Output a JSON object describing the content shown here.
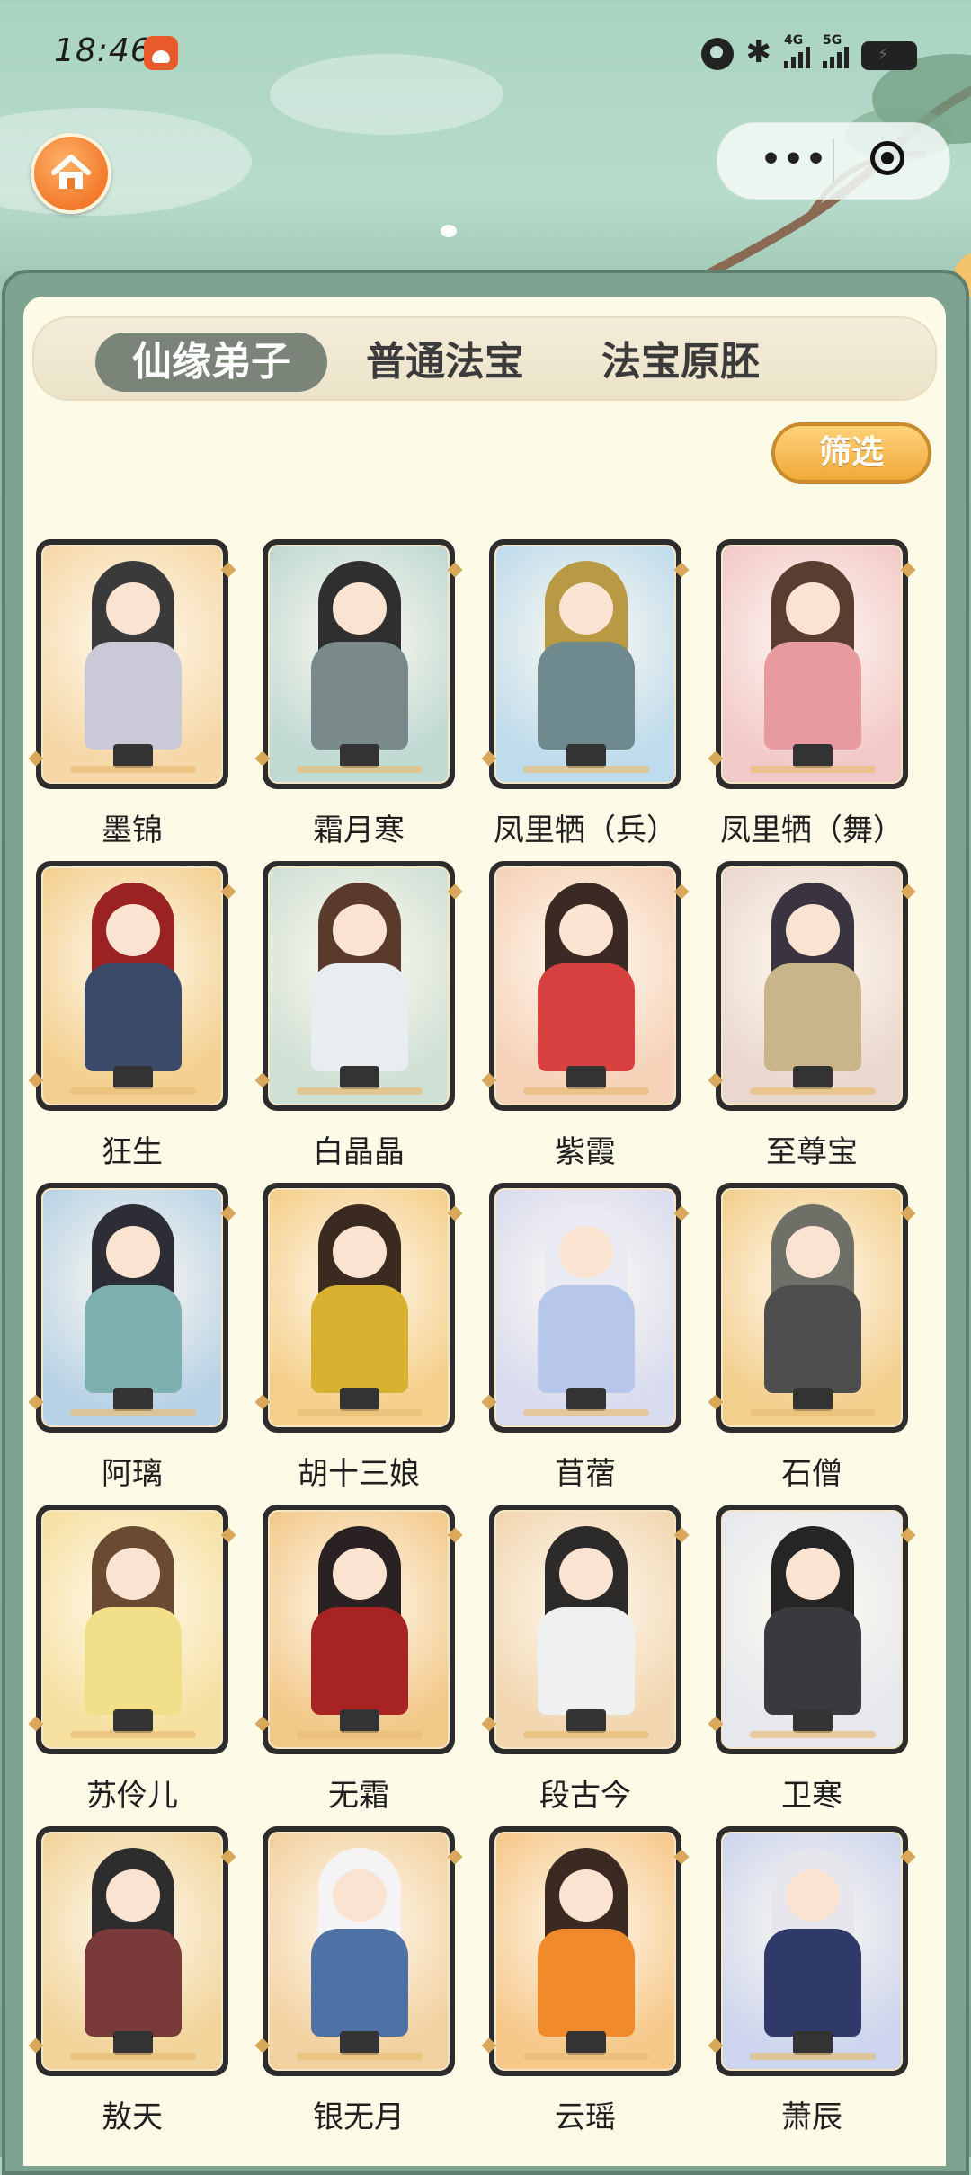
{
  "status_bar": {
    "time": "18:46",
    "network_1": "4G",
    "network_2": "5G"
  },
  "top_nav": {
    "home_icon": "home-icon",
    "capsule_more": "•••",
    "capsule_close_icon": "target-icon"
  },
  "tabs": [
    {
      "label": "仙缘弟子",
      "active": true
    },
    {
      "label": "普通法宝",
      "active": false
    },
    {
      "label": "法宝原胚",
      "active": false
    }
  ],
  "filter_label": "筛选",
  "characters": [
    {
      "name": "墨锦",
      "bg": "#f6d8a8",
      "hair": "#3a3a3a",
      "body": "#c9c9d8"
    },
    {
      "name": "霜月寒",
      "bg": "#bfd9d3",
      "hair": "#2f2f2f",
      "body": "#7a8a8a"
    },
    {
      "name": "凤里牺（兵）",
      "bg": "#bfdcec",
      "hair": "#b99a44",
      "body": "#6e8a8e"
    },
    {
      "name": "凤里牺（舞）",
      "bg": "#f2c9c9",
      "hair": "#5a3c30",
      "body": "#e79aa0"
    },
    {
      "name": "狂生",
      "bg": "#f3d08f",
      "hair": "#9a2222",
      "body": "#3c4a6a"
    },
    {
      "name": "白晶晶",
      "bg": "#cfe0d4",
      "hair": "#5a3a2a",
      "body": "#e8eef0"
    },
    {
      "name": "紫霞",
      "bg": "#f6d2b8",
      "hair": "#3b2a24",
      "body": "#d84040"
    },
    {
      "name": "至尊宝",
      "bg": "#ead8cf",
      "hair": "#3a3340",
      "body": "#c8b58a"
    },
    {
      "name": "阿璃",
      "bg": "#b9d3e6",
      "hair": "#2d2d36",
      "body": "#7fb0b0"
    },
    {
      "name": "胡十三娘",
      "bg": "#f5cf8a",
      "hair": "#3a2a20",
      "body": "#d8b030"
    },
    {
      "name": "苜蓿",
      "bg": "#d9dcef",
      "hair": "#eaeaf2",
      "body": "#b7c7ea"
    },
    {
      "name": "石僧",
      "bg": "#f3cf8d",
      "hair": "#6e7068",
      "body": "#4e4e4e"
    },
    {
      "name": "苏伶儿",
      "bg": "#f6e0a0",
      "hair": "#6a4a30",
      "body": "#f2df8a"
    },
    {
      "name": "无霜",
      "bg": "#f3c98a",
      "hair": "#2a2222",
      "body": "#a82424"
    },
    {
      "name": "段古今",
      "bg": "#f1d6b0",
      "hair": "#2d2a2a",
      "body": "#eef0f2"
    },
    {
      "name": "卫寒",
      "bg": "#e6e8ee",
      "hair": "#252526",
      "body": "#3a3a3e"
    },
    {
      "name": "敖天",
      "bg": "#f1d49a",
      "hair": "#2d2d2d",
      "body": "#7a3a3a"
    },
    {
      "name": "银无月",
      "bg": "#f2d1a0",
      "hair": "#f4f4f6",
      "body": "#4f72a6"
    },
    {
      "name": "云瑶",
      "bg": "#f6c88a",
      "hair": "#3a2a22",
      "body": "#f08a2a"
    },
    {
      "name": "萧辰",
      "bg": "#cdd6ee",
      "hair": "#e6e6ec",
      "body": "#2f3a6a"
    }
  ]
}
